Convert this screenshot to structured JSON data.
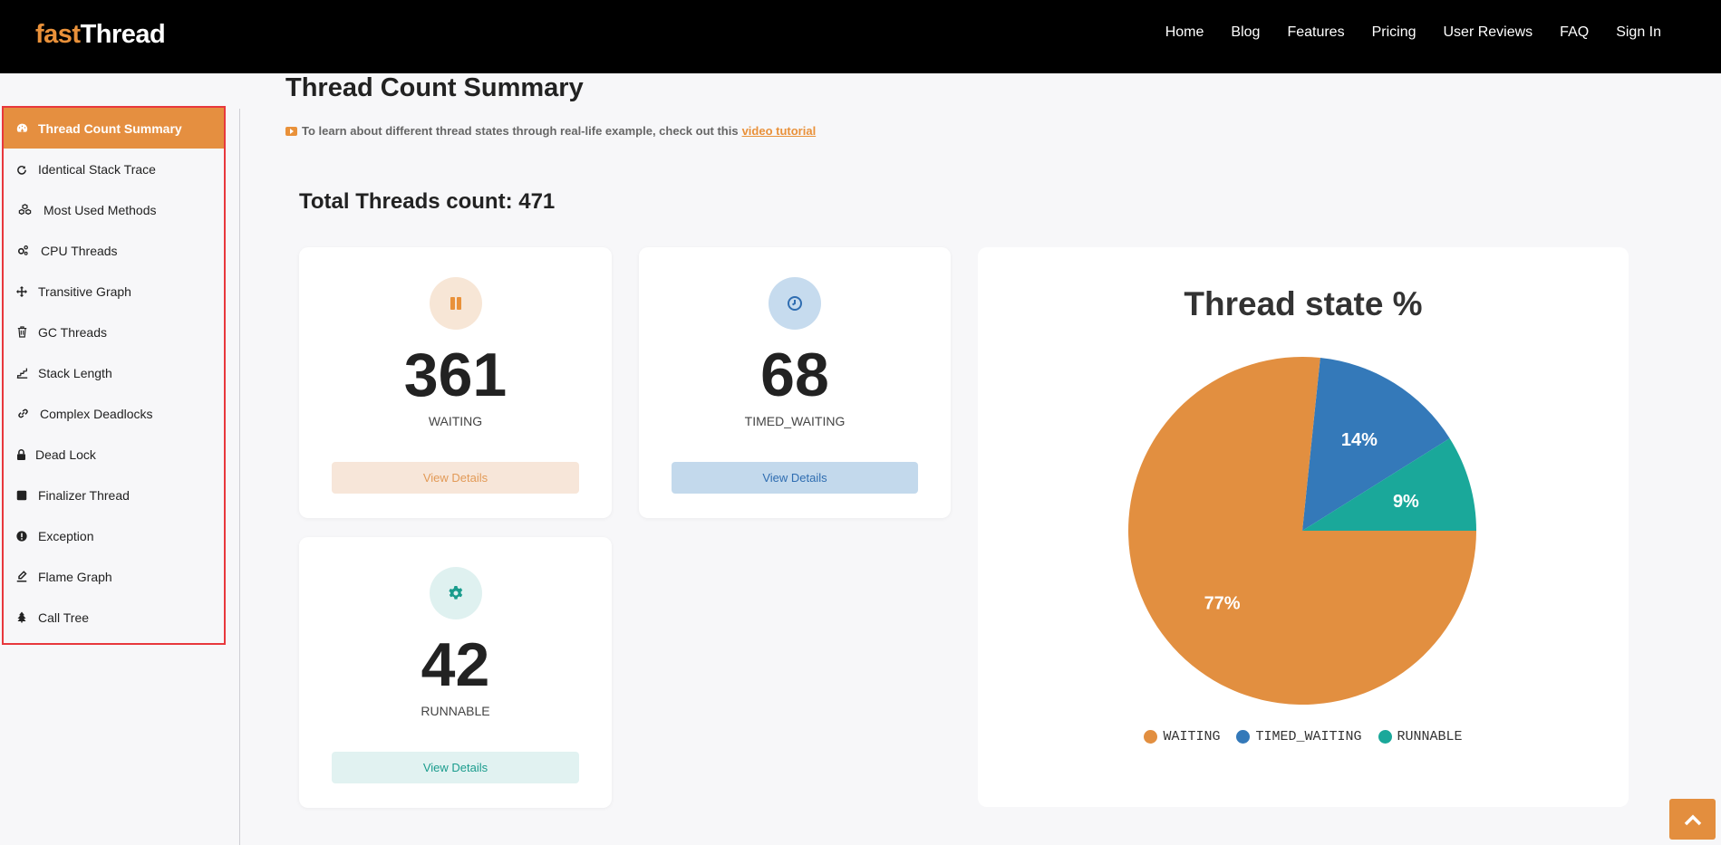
{
  "header": {
    "logo_fast": "fast",
    "logo_thread": "Thread",
    "nav": [
      "Home",
      "Blog",
      "Features",
      "Pricing",
      "User Reviews",
      "FAQ",
      "Sign In"
    ]
  },
  "sidebar": {
    "items": [
      {
        "label": "Thread Count Summary",
        "icon": "dashboard-icon",
        "active": true
      },
      {
        "label": "Identical Stack Trace",
        "icon": "refresh-icon"
      },
      {
        "label": "Most Used Methods",
        "icon": "cubes-icon"
      },
      {
        "label": "CPU Threads",
        "icon": "cogs-icon"
      },
      {
        "label": "Transitive Graph",
        "icon": "arrows-icon"
      },
      {
        "label": "GC Threads",
        "icon": "trash-icon"
      },
      {
        "label": "Stack Length",
        "icon": "stairs-icon"
      },
      {
        "label": "Complex Deadlocks",
        "icon": "link-icon"
      },
      {
        "label": "Dead Lock",
        "icon": "lock-icon"
      },
      {
        "label": "Finalizer Thread",
        "icon": "stop-icon"
      },
      {
        "label": "Exception",
        "icon": "exclamation-icon"
      },
      {
        "label": "Flame Graph",
        "icon": "pencil-icon"
      },
      {
        "label": "Call Tree",
        "icon": "tree-icon"
      }
    ]
  },
  "main": {
    "title": "Thread Count Summary",
    "tutorial_text": "To learn about different thread states through real-life example, check out this",
    "tutorial_link": "video tutorial",
    "total_label": "Total Threads count: 471"
  },
  "cards": {
    "waiting": {
      "count": "361",
      "label": "WAITING",
      "button": "View Details",
      "icon": "pause-icon"
    },
    "timed": {
      "count": "68",
      "label": "TIMED_WAITING",
      "button": "View Details",
      "icon": "clock-icon"
    },
    "runnable": {
      "count": "42",
      "label": "RUNNABLE",
      "button": "View Details",
      "icon": "gear-icon"
    }
  },
  "colors": {
    "waiting": "#e28f40",
    "timed_waiting": "#3479b9",
    "runnable": "#1aa89a",
    "accent": "#e9913a"
  },
  "chart_data": {
    "type": "pie",
    "title": "Thread state %",
    "categories": [
      "WAITING",
      "TIMED_WAITING",
      "RUNNABLE"
    ],
    "values": [
      361,
      68,
      42
    ],
    "labels": [
      "77%",
      "14%",
      "9%"
    ],
    "legend": "bottom"
  },
  "scroll_top_icon": "chevron-up-icon"
}
